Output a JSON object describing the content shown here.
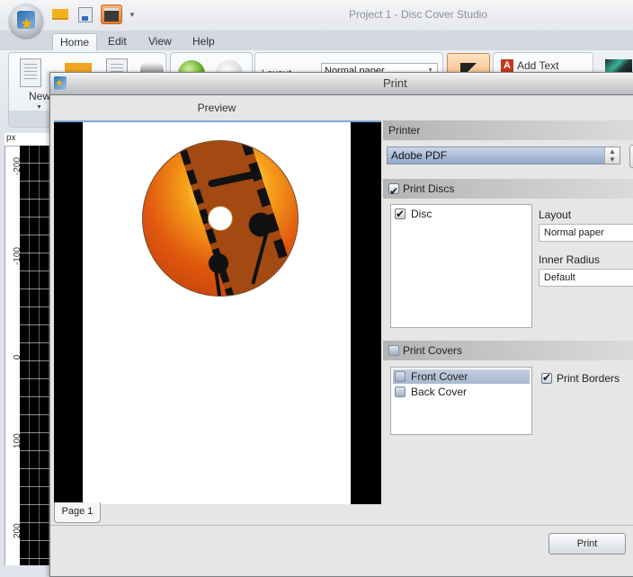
{
  "app": {
    "title": "Project 1 - Disc Cover Studio",
    "quick_access": [
      "open-icon",
      "save-icon",
      "print-icon",
      "customize-arrow"
    ],
    "ribbon_tabs": [
      {
        "label": "Home",
        "active": true
      },
      {
        "label": "Edit",
        "active": false
      },
      {
        "label": "View",
        "active": false
      },
      {
        "label": "Help",
        "active": false
      }
    ],
    "ribbon": {
      "new_label": "New",
      "layout_label": "Layout",
      "layout_value": "Normal paper",
      "add_text_label": "Add Text"
    },
    "ruler": {
      "unit": "px",
      "labels": [
        "-200",
        "-100",
        "0",
        "100",
        "200"
      ]
    }
  },
  "dialog": {
    "title": "Print",
    "preview_label": "Preview",
    "page_tab": "Page 1",
    "printer": {
      "header": "Printer",
      "selected": "Adobe PDF"
    },
    "print_discs": {
      "header": "Print Discs",
      "checked": true,
      "items": [
        {
          "label": "Disc",
          "checked": true
        }
      ],
      "layout_label": "Layout",
      "layout_value": "Normal paper",
      "inner_radius_label": "Inner Radius",
      "inner_radius_value": "Default"
    },
    "print_covers": {
      "header": "Print Covers",
      "checked": false,
      "items": [
        {
          "label": "Front Cover",
          "checked": false,
          "selected": true
        },
        {
          "label": "Back Cover",
          "checked": false,
          "selected": false
        }
      ],
      "print_borders_label": "Print Borders",
      "print_borders_checked": true
    },
    "print_button": "Print"
  }
}
